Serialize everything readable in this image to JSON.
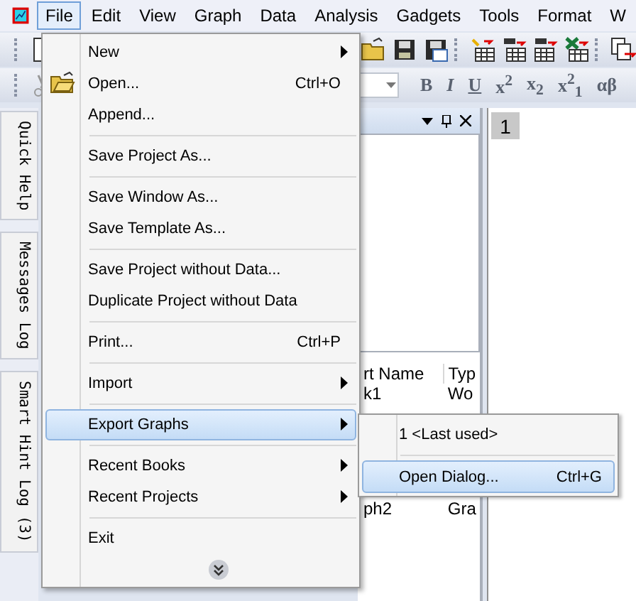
{
  "menubar": [
    {
      "label": "File",
      "selected": true
    },
    {
      "label": "Edit",
      "selected": false
    },
    {
      "label": "View",
      "selected": false
    },
    {
      "label": "Graph",
      "selected": false
    },
    {
      "label": "Data",
      "selected": false
    },
    {
      "label": "Analysis",
      "selected": false
    },
    {
      "label": "Gadgets",
      "selected": false
    },
    {
      "label": "Tools",
      "selected": false
    },
    {
      "label": "Format",
      "selected": false
    },
    {
      "label": "W",
      "selected": false
    }
  ],
  "format_toolbar": [
    "B",
    "I",
    "U",
    "x$^{2}$",
    "x$_{2}$",
    "x$^{2}$$_{1}$",
    "αβ"
  ],
  "side_tabs": [
    "Quick Help",
    "Messages Log",
    "Smart Hint Log (3)"
  ],
  "explorer": {
    "columns": [
      "rt Name",
      "Typ"
    ],
    "rows": [
      [
        "k1",
        "Wo"
      ],
      [
        "ph2",
        "Gra"
      ]
    ]
  },
  "worksheet": {
    "columns": [
      "1"
    ]
  },
  "file_menu": [
    {
      "kind": "item",
      "label": "New",
      "submenu": true,
      "selected": false
    },
    {
      "kind": "item",
      "label": "Open...",
      "shortcut": "Ctrl+O",
      "icon": true,
      "selected": false
    },
    {
      "kind": "item",
      "label": "Append...",
      "selected": false
    },
    {
      "kind": "separator"
    },
    {
      "kind": "item",
      "label": "Save Project As...",
      "selected": false
    },
    {
      "kind": "separator"
    },
    {
      "kind": "item",
      "label": "Save Window As...",
      "selected": false
    },
    {
      "kind": "item",
      "label": "Save Template As...",
      "selected": false
    },
    {
      "kind": "separator"
    },
    {
      "kind": "item",
      "label": "Save Project without Data...",
      "selected": false
    },
    {
      "kind": "item",
      "label": "Duplicate Project without Data",
      "selected": false
    },
    {
      "kind": "separator"
    },
    {
      "kind": "item",
      "label": "Print...",
      "shortcut": "Ctrl+P",
      "selected": false
    },
    {
      "kind": "separator"
    },
    {
      "kind": "item",
      "label": "Import",
      "submenu": true,
      "selected": false
    },
    {
      "kind": "separator"
    },
    {
      "kind": "item",
      "label": "Export Graphs",
      "submenu": true,
      "selected": true
    },
    {
      "kind": "separator"
    },
    {
      "kind": "item",
      "label": "Recent Books",
      "submenu": true,
      "selected": false
    },
    {
      "kind": "item",
      "label": "Recent Projects",
      "submenu": true,
      "selected": false
    },
    {
      "kind": "separator"
    },
    {
      "kind": "item",
      "label": "Exit",
      "selected": false
    },
    {
      "kind": "more"
    }
  ],
  "export_submenu": [
    {
      "kind": "item",
      "label": "1 <Last used>",
      "selected": false
    },
    {
      "kind": "separator"
    },
    {
      "kind": "item",
      "label": "Open Dialog...",
      "shortcut": "Ctrl+G",
      "selected": true
    }
  ]
}
